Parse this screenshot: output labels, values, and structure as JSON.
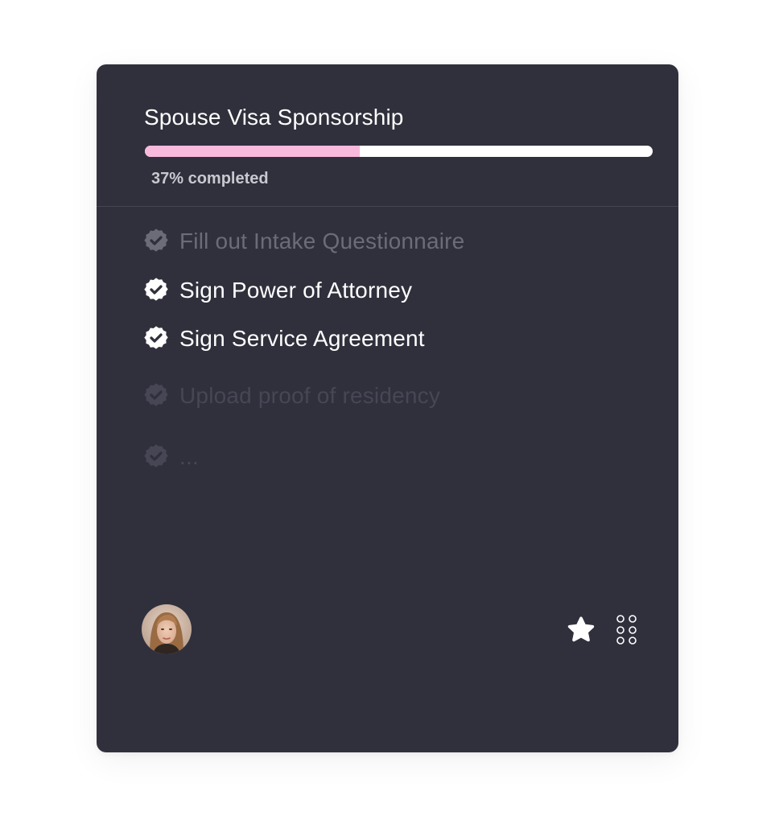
{
  "card": {
    "title": "Spouse Visa Sponsorship",
    "progress": {
      "fraction": 0.423,
      "label": "37% completed",
      "fill_color": "#f9b9dd",
      "track_color": "#ffffff"
    },
    "tasks": [
      {
        "label": "Fill out Intake Questionnaire",
        "state": "muted",
        "icon": "check-badge-icon"
      },
      {
        "label": "Sign Power of Attorney",
        "state": "done",
        "icon": "check-badge-icon"
      },
      {
        "label": "Sign Service Agreement",
        "state": "done",
        "icon": "check-badge-icon"
      },
      {
        "label": "Upload proof of residency",
        "state": "faint",
        "icon": "check-badge-icon"
      },
      {
        "label": "...",
        "state": "faint",
        "icon": "check-badge-icon"
      }
    ],
    "footer": {
      "avatar": "user-avatar",
      "actions": [
        "star-icon",
        "apps-grid-icon"
      ]
    }
  },
  "colors": {
    "card_bg": "#30303d",
    "done": "#ffffff",
    "muted": "#6c6c79",
    "faint": "#464654"
  }
}
